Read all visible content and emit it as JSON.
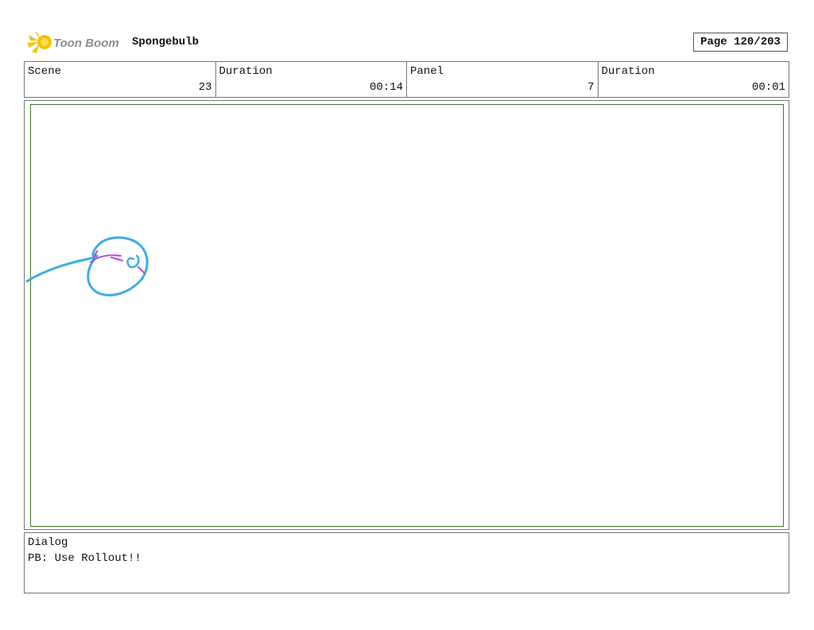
{
  "header": {
    "logo_text": "Toon Boom",
    "project_title": "Spongebulb",
    "page_label": "Page 120/203"
  },
  "info": {
    "scene_label": "Scene",
    "scene_value": "23",
    "scene_duration_label": "Duration",
    "scene_duration_value": "00:14",
    "panel_label": "Panel",
    "panel_value": "7",
    "panel_duration_label": "Duration",
    "panel_duration_value": "00:01"
  },
  "dialog": {
    "label": "Dialog",
    "text": "PB: Use Rollout!!"
  },
  "colors": {
    "panel_border": "#3b7a2a",
    "sketch_blue": "#3aaee6",
    "sketch_purple": "#b04fd0",
    "logo_yellow": "#f2c200",
    "logo_gray": "#8a8f96"
  }
}
